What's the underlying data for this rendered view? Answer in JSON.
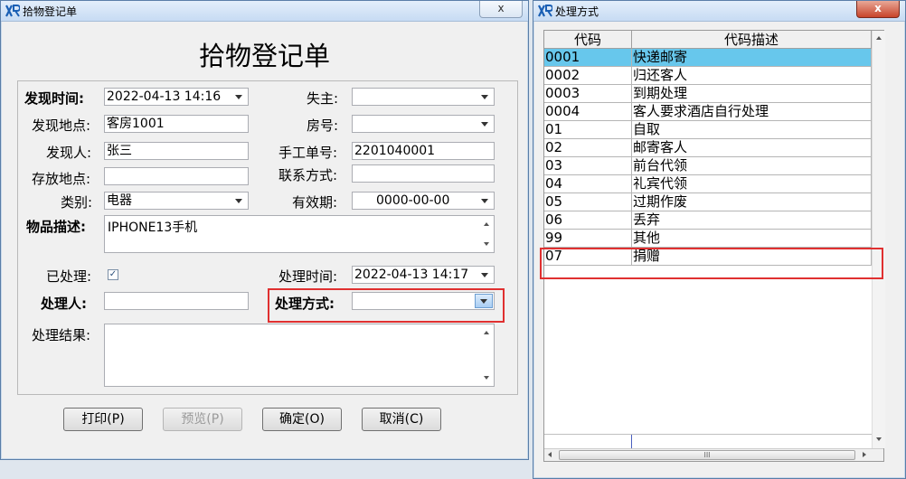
{
  "main_window": {
    "title": "拾物登记单",
    "close_label": "x",
    "form_title": "拾物登记单",
    "fields": {
      "found_time": {
        "label": "发现时间:",
        "value": "2022-04-13 14:16"
      },
      "found_place": {
        "label": "发现地点:",
        "value": "客房1001"
      },
      "finder": {
        "label": "发现人:",
        "value": "张三"
      },
      "storage_place": {
        "label": "存放地点:",
        "value": ""
      },
      "category": {
        "label": "类别:",
        "value": "电器"
      },
      "item_desc": {
        "label": "物品描述:",
        "value": "IPHONE13手机"
      },
      "processed": {
        "label": "已处理:",
        "checked": true
      },
      "handler": {
        "label": "处理人:",
        "value": ""
      },
      "result": {
        "label": "处理结果:",
        "value": ""
      },
      "owner": {
        "label": "失主:",
        "value": ""
      },
      "room_no": {
        "label": "房号:",
        "value": ""
      },
      "manual_no": {
        "label": "手工单号:",
        "value": "2201040001"
      },
      "contact": {
        "label": "联系方式:",
        "value": ""
      },
      "valid_until": {
        "label": "有效期:",
        "value": "0000-00-00"
      },
      "process_time": {
        "label": "处理时间:",
        "value": "2022-04-13 14:17"
      },
      "process_method": {
        "label": "处理方式:",
        "value": ""
      }
    },
    "buttons": {
      "print": "打印(P)",
      "preview": "预览(P)",
      "ok": "确定(O)",
      "cancel": "取消(C)"
    }
  },
  "popup_window": {
    "title": "处理方式",
    "close_label": "x",
    "columns": [
      "代码",
      "代码描述"
    ],
    "rows": [
      {
        "code": "0001",
        "desc": "快递邮寄"
      },
      {
        "code": "0002",
        "desc": "归还客人"
      },
      {
        "code": "0003",
        "desc": "到期处理"
      },
      {
        "code": "0004",
        "desc": "客人要求酒店自行处理"
      },
      {
        "code": "01",
        "desc": "自取"
      },
      {
        "code": "02",
        "desc": "邮寄客人"
      },
      {
        "code": "03",
        "desc": "前台代领"
      },
      {
        "code": "04",
        "desc": "礼宾代领"
      },
      {
        "code": "05",
        "desc": "过期作废"
      },
      {
        "code": "06",
        "desc": "丢弃"
      },
      {
        "code": "99",
        "desc": "其他"
      },
      {
        "code": "07",
        "desc": "捐赠"
      }
    ],
    "selected_index": 0,
    "hscroll_thumb": "III"
  },
  "colors": {
    "selected_row": "#67c7ec",
    "highlight_border": "#e03030",
    "titlebar": "#c7dbf3"
  }
}
